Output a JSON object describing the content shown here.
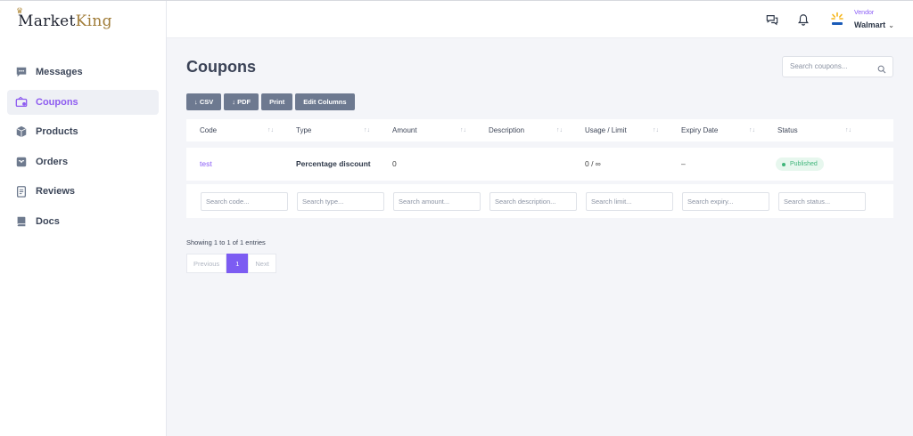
{
  "brand": {
    "logo_main": "Market",
    "logo_accent": "King"
  },
  "sidebar": {
    "items": [
      {
        "label": "Messages",
        "icon": "message-icon",
        "active": false
      },
      {
        "label": "Coupons",
        "icon": "coupon-icon",
        "active": true
      },
      {
        "label": "Products",
        "icon": "box-icon",
        "active": false
      },
      {
        "label": "Orders",
        "icon": "inbox-icon",
        "active": false
      },
      {
        "label": "Reviews",
        "icon": "clipboard-icon",
        "active": false
      },
      {
        "label": "Docs",
        "icon": "book-icon",
        "active": false
      }
    ]
  },
  "header": {
    "vendor_role": "Vendor",
    "vendor_name": "Walmart",
    "icons": [
      "chat-icon",
      "bell-icon",
      "walmart-logo-icon"
    ]
  },
  "page": {
    "title": "Coupons",
    "search_placeholder": "Search coupons..."
  },
  "toolbar": {
    "csv_label": "↓ CSV",
    "pdf_label": "↓ PDF",
    "print_label": "Print",
    "edit_columns_label": "Edit Columns"
  },
  "table": {
    "columns": [
      "Code",
      "Type",
      "Amount",
      "Description",
      "Usage / Limit",
      "Expiry Date",
      "Status"
    ],
    "rows": [
      {
        "code": "test",
        "type": "Percentage discount",
        "amount": "0",
        "description": "",
        "usage": "0 / ∞",
        "expiry": "–",
        "status": "Published"
      }
    ],
    "filters": [
      "Search code...",
      "Search type...",
      "Search amount...",
      "Search description...",
      "Search limit...",
      "Search expiry...",
      "Search status..."
    ]
  },
  "footer": {
    "entries_text": "Showing 1 to 1 of 1 entries",
    "prev_label": "Previous",
    "page_label": "1",
    "next_label": "Next"
  },
  "colors": {
    "accent": "#7c5cf2",
    "published": "#3fb57a",
    "button": "#6d7990"
  }
}
